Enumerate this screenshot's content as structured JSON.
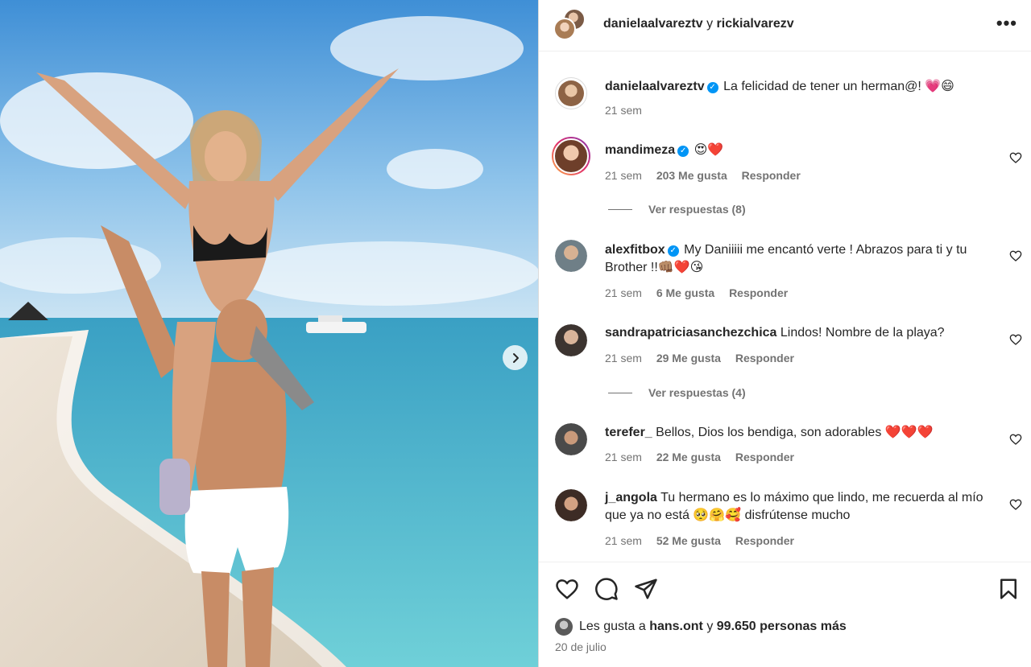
{
  "header": {
    "user1": "danielaalvareztv",
    "conj": "y",
    "user2": "rickialvarezv",
    "more": "•••"
  },
  "comments": [
    {
      "username": "danielaalvareztv",
      "verified": true,
      "text": "La felicidad de tener un herman@! 💗😄",
      "time": "21 sem"
    },
    {
      "username": "mandimeza",
      "verified": true,
      "text": "😍❤️",
      "time": "21 sem",
      "likes": "203 Me gusta",
      "reply": "Responder",
      "view_replies": "Ver respuestas (8)"
    },
    {
      "username": "alexfitbox",
      "verified": true,
      "text": "My Daniiiii me encantó verte ! Abrazos para ti y tu Brother !!👊🏽❤️😘",
      "time": "21 sem",
      "likes": "6 Me gusta",
      "reply": "Responder"
    },
    {
      "username": "sandrapatriciasanchezchica",
      "verified": false,
      "text": "Lindos! Nombre de la playa?",
      "time": "21 sem",
      "likes": "29 Me gusta",
      "reply": "Responder",
      "view_replies": "Ver respuestas (4)"
    },
    {
      "username": "terefer_",
      "verified": false,
      "text": "Bellos, Dios los bendiga, son adorables ❤️❤️❤️",
      "time": "21 sem",
      "likes": "22 Me gusta",
      "reply": "Responder"
    },
    {
      "username": "j_angola",
      "verified": false,
      "text": "Tu hermano es lo máximo que lindo, me recuerda al mío que ya no está 🥺🤗🥰 disfrútense mucho",
      "time": "21 sem",
      "likes": "52 Me gusta",
      "reply": "Responder"
    }
  ],
  "footer": {
    "likes_prefix": "Les gusta a",
    "likes_user": "hans.ont",
    "likes_conj": "y",
    "likes_count": "99.650 personas más",
    "date": "20 de julio"
  },
  "colors": {
    "verified": "#0095f6",
    "secondary_text": "#737373",
    "primary_text": "#262626"
  }
}
